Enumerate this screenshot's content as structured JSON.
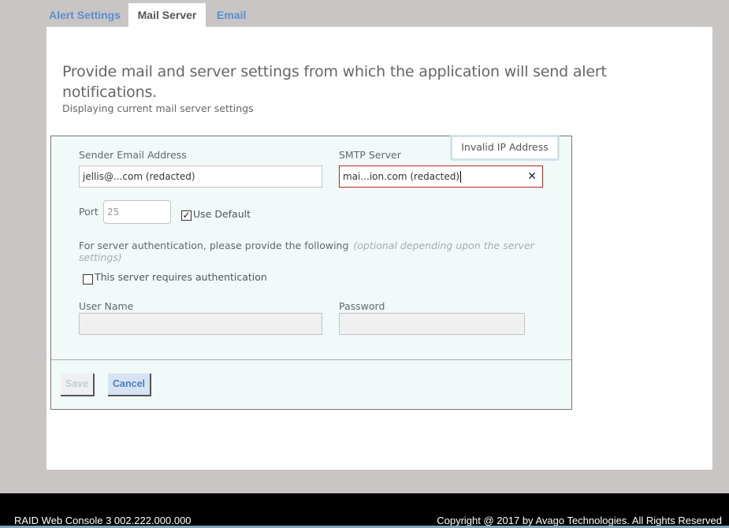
{
  "tabs": [
    {
      "label": "Alert Settings",
      "active": false
    },
    {
      "label": "Mail Server",
      "active": true
    },
    {
      "label": "Email",
      "active": false
    }
  ],
  "header": {
    "headline": "Provide mail and server settings from which the application will send alert notifications.",
    "subline": "Displaying current mail server settings"
  },
  "form": {
    "sender_email": {
      "label": "Sender Email Address",
      "value": "jellis@...com (redacted)"
    },
    "smtp_server": {
      "label": "SMTP Server",
      "value": "mai...ion.com (redacted)",
      "error_tooltip": "Invalid IP Address",
      "clear_icon": "close-icon"
    },
    "port": {
      "label": "Port",
      "value": "25",
      "use_default_label": "Use Default",
      "use_default_checked": true
    },
    "auth_note": "For server authentication, please provide the following",
    "auth_optional": "(optional depending upon the server settings)",
    "requires_auth": {
      "label": "This server requires authentication",
      "checked": false
    },
    "username": {
      "label": "User Name",
      "value": ""
    },
    "password": {
      "label": "Password",
      "value": ""
    }
  },
  "buttons": {
    "save": "Save",
    "cancel": "Cancel"
  },
  "footer": {
    "left": "RAID Web Console 3   002.222.000.000",
    "right": "Copyright @ 2017 by Avago Technologies. All Rights Reserved"
  },
  "colors": {
    "accent": "#5b8fcf",
    "error": "#b3262b",
    "form_bg": "#f1f9f9"
  }
}
